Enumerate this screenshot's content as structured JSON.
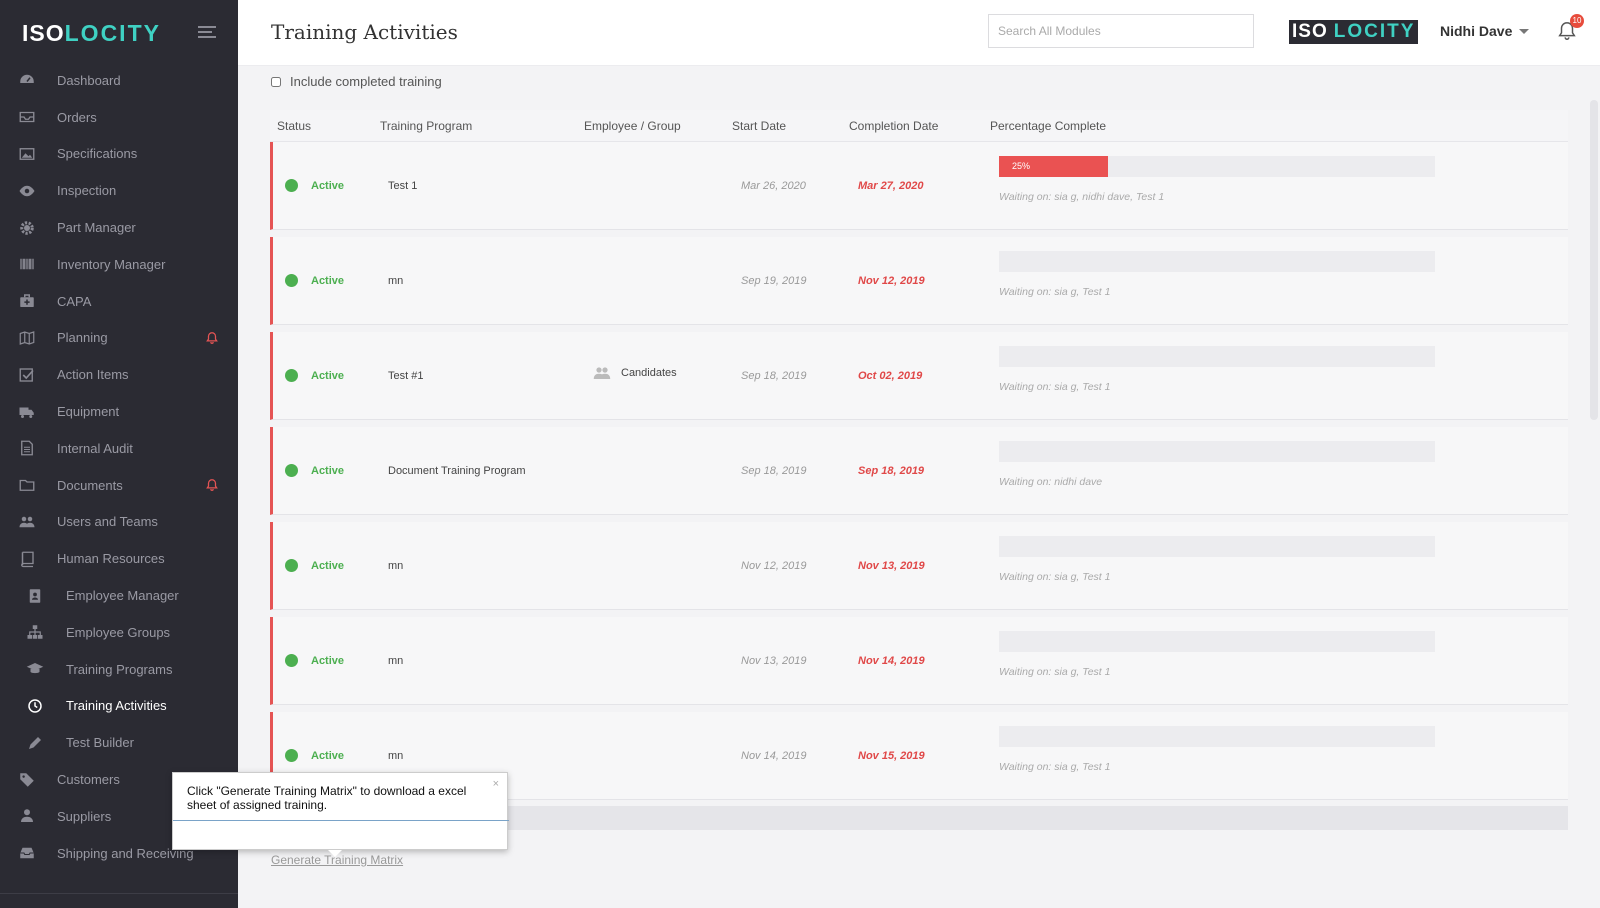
{
  "brand": {
    "iso": "ISO",
    "locity": "LOCITY",
    "accent": "#3fd1c3"
  },
  "sidebar": {
    "items": [
      {
        "label": "Dashboard",
        "icon": "dashboard-icon"
      },
      {
        "label": "Orders",
        "icon": "inbox-icon"
      },
      {
        "label": "Specifications",
        "icon": "image-icon"
      },
      {
        "label": "Inspection",
        "icon": "eye-icon"
      },
      {
        "label": "Part Manager",
        "icon": "gear-icon"
      },
      {
        "label": "Inventory Manager",
        "icon": "barcode-icon"
      },
      {
        "label": "CAPA",
        "icon": "medkit-icon"
      },
      {
        "label": "Planning",
        "icon": "map-icon",
        "alert": true
      },
      {
        "label": "Action Items",
        "icon": "checkbox-icon"
      },
      {
        "label": "Equipment",
        "icon": "truck-icon"
      },
      {
        "label": "Internal Audit",
        "icon": "file-icon"
      },
      {
        "label": "Documents",
        "icon": "folder-icon",
        "alert": true
      },
      {
        "label": "Users and Teams",
        "icon": "users-icon"
      },
      {
        "label": "Human Resources",
        "icon": "book-icon"
      },
      {
        "label": "Employee Manager",
        "icon": "id-badge-icon",
        "sub": true
      },
      {
        "label": "Employee Groups",
        "icon": "sitemap-icon",
        "sub": true
      },
      {
        "label": "Training Programs",
        "icon": "graduation-cap-icon",
        "sub": true
      },
      {
        "label": "Training Activities",
        "icon": "clock-icon",
        "sub": true,
        "active": true
      },
      {
        "label": "Test Builder",
        "icon": "pencil-icon",
        "sub": true
      },
      {
        "label": "Customers",
        "icon": "tag-icon",
        "alert": true
      },
      {
        "label": "Suppliers",
        "icon": "supplier-icon"
      },
      {
        "label": "Shipping and Receiving",
        "icon": "tray-icon"
      }
    ]
  },
  "header": {
    "title": "Training Activities",
    "search_placeholder": "Search All Modules",
    "user_name": "Nidhi Dave",
    "notification_count": "10"
  },
  "filters": {
    "include_completed_label": "Include completed training"
  },
  "table": {
    "columns": [
      "Status",
      "Training Program",
      "Employee / Group",
      "Start Date",
      "Completion Date",
      "Percentage Complete"
    ],
    "rows": [
      {
        "status": "Active",
        "program": "Test 1",
        "group": "",
        "start": "Mar 26, 2020",
        "completion": "Mar 27, 2020",
        "percent": 25,
        "percent_label": "25%",
        "waiting": "Waiting on: sia g, nidhi dave, Test 1"
      },
      {
        "status": "Active",
        "program": "mn",
        "group": "",
        "start": "Sep 19, 2019",
        "completion": "Nov 12, 2019",
        "percent": 0,
        "percent_label": "",
        "waiting": "Waiting on: sia g, Test 1"
      },
      {
        "status": "Active",
        "program": "Test #1",
        "group": "Candidates",
        "start": "Sep 18, 2019",
        "completion": "Oct 02, 2019",
        "percent": 0,
        "percent_label": "",
        "waiting": "Waiting on: sia g, Test 1"
      },
      {
        "status": "Active",
        "program": "Document Training Program",
        "group": "",
        "start": "Sep 18, 2019",
        "completion": "Sep 18, 2019",
        "percent": 0,
        "percent_label": "",
        "waiting": "Waiting on: nidhi dave"
      },
      {
        "status": "Active",
        "program": "mn",
        "group": "",
        "start": "Nov 12, 2019",
        "completion": "Nov 13, 2019",
        "percent": 0,
        "percent_label": "",
        "waiting": "Waiting on: sia g, Test 1"
      },
      {
        "status": "Active",
        "program": "mn",
        "group": "",
        "start": "Nov 13, 2019",
        "completion": "Nov 14, 2019",
        "percent": 0,
        "percent_label": "",
        "waiting": "Waiting on: sia g, Test 1"
      },
      {
        "status": "Active",
        "program": "mn",
        "group": "",
        "start": "Nov 14, 2019",
        "completion": "Nov 15, 2019",
        "percent": 0,
        "percent_label": "",
        "waiting": "Waiting on: sia g, Test 1"
      }
    ]
  },
  "footer": {
    "generate_matrix_label": "Generate Training Matrix"
  },
  "tooltip": {
    "text": "Click \"Generate Training Matrix\" to download a excel sheet of assigned training.",
    "close": "×"
  },
  "colors": {
    "active_status": "#4caf50",
    "due_date": "#e04848",
    "progress_fill": "#ea5252",
    "sidebar_bg": "#2b2b33"
  }
}
